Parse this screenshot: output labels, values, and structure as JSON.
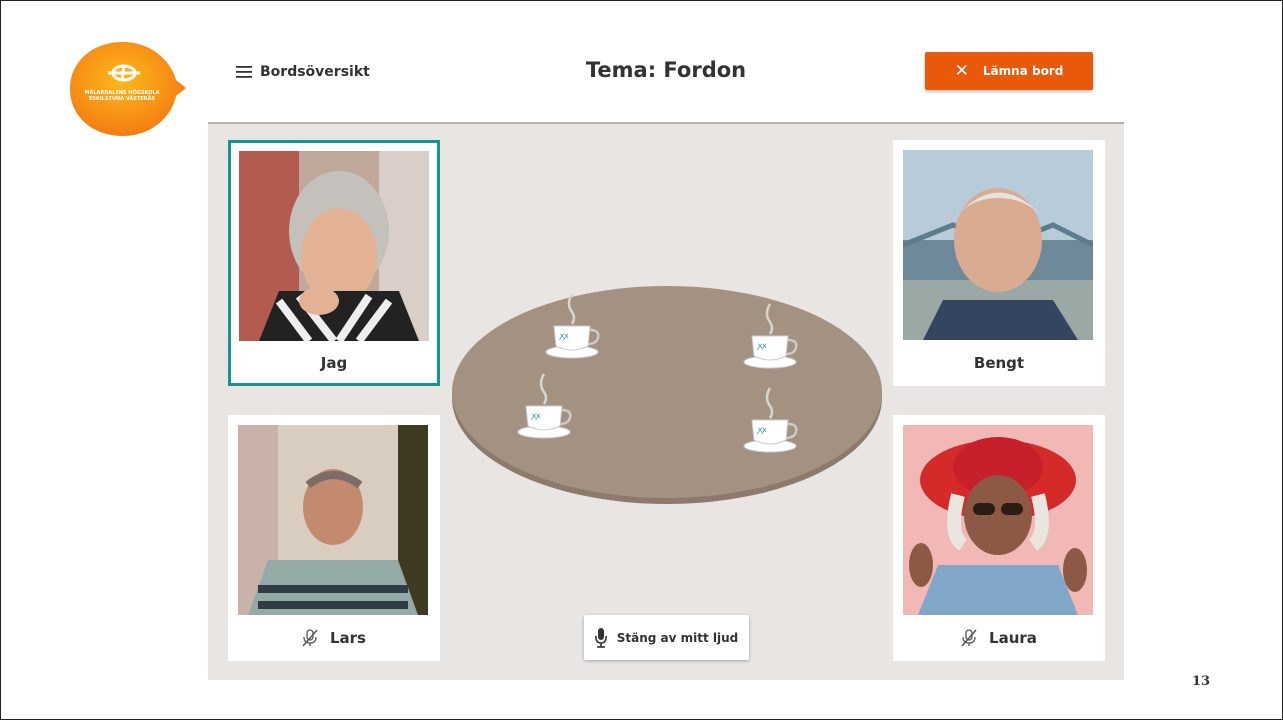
{
  "logo": {
    "lines": [
      "MÄLARDALENS HÖGSKOLA",
      "ESKILSTUNA VÄSTERÅS"
    ],
    "color": "#f7941d"
  },
  "header": {
    "menu_label": "Bordsöversikt",
    "title": "Tema: Fordon",
    "leave_label": "Lämna bord",
    "leave_color": "#e8590c"
  },
  "participants": [
    {
      "name": "Jag",
      "active": true,
      "muted": false,
      "icon": "portrait-photo"
    },
    {
      "name": "Bengt",
      "active": false,
      "muted": false,
      "icon": "portrait-photo"
    },
    {
      "name": "Lars",
      "active": false,
      "muted": true,
      "icon": "microphone-muted-icon"
    },
    {
      "name": "Laura",
      "active": false,
      "muted": true,
      "icon": "microphone-muted-icon"
    }
  ],
  "table": {
    "cups": 4,
    "color": "#a39282"
  },
  "controls": {
    "mute_label": "Stäng av mitt ljud"
  },
  "active_color": "#16948f",
  "slide_number": "13"
}
